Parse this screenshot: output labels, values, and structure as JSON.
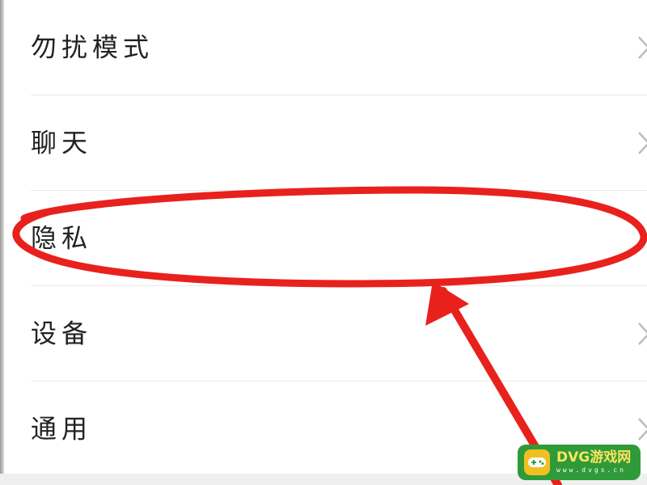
{
  "settings": {
    "items": [
      {
        "label": "勿扰模式",
        "icon": "chevron-right-icon"
      },
      {
        "label": "聊天",
        "icon": "chevron-right-icon"
      },
      {
        "label": "隐私",
        "icon": "chevron-right-icon"
      },
      {
        "label": "设备",
        "icon": "chevron-right-icon"
      },
      {
        "label": "通用",
        "icon": "chevron-right-icon"
      }
    ],
    "highlighted_item": "隐私"
  },
  "annotation": {
    "shape": "ellipse-with-arrow",
    "color": "#e8211c"
  },
  "watermark": {
    "brand": "DVG游戏网",
    "site": "www.dvgs.cn",
    "background": "#2f9a3a",
    "text_color": "#ffe45c"
  }
}
